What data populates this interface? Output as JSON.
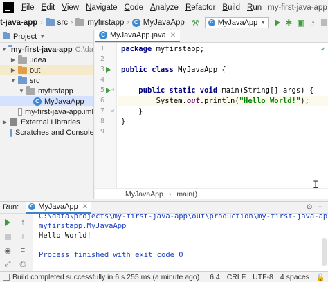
{
  "menubar": {
    "items": [
      "File",
      "Edit",
      "View",
      "Navigate",
      "Code",
      "Analyze",
      "Refactor",
      "Build",
      "Run"
    ],
    "window_title": "my-first-java-app"
  },
  "navbar": {
    "crumbs": [
      "t-java-app",
      "src",
      "myfirstapp",
      "MyJavaApp"
    ],
    "run_config": "MyJavaApp"
  },
  "project": {
    "header": "Project",
    "tree": [
      {
        "label": "my-first-java-app",
        "note": "C:\\data\\",
        "depth": 0,
        "expanded": true,
        "icon": "folder"
      },
      {
        "label": ".idea",
        "depth": 1,
        "expanded": false,
        "icon": "folder-grey"
      },
      {
        "label": "out",
        "depth": 1,
        "expanded": false,
        "icon": "folder-orange",
        "highlight": true
      },
      {
        "label": "src",
        "depth": 1,
        "expanded": true,
        "icon": "folder-blue"
      },
      {
        "label": "myfirstapp",
        "depth": 2,
        "expanded": true,
        "icon": "package"
      },
      {
        "label": "MyJavaApp",
        "depth": 3,
        "icon": "class",
        "selected": true
      },
      {
        "label": "my-first-java-app.iml",
        "depth": 1,
        "icon": "file"
      },
      {
        "label": "External Libraries",
        "depth": 0,
        "expanded": false,
        "icon": "library"
      },
      {
        "label": "Scratches and Consoles",
        "depth": 0,
        "expanded": false,
        "icon": "scratches"
      }
    ]
  },
  "editor": {
    "tab_label": "MyJavaApp.java",
    "line_numbers": [
      "1",
      "2",
      "3",
      "4",
      "5",
      "6",
      "7",
      "8",
      "9"
    ],
    "breadcrumb": [
      "MyJavaApp",
      "main()"
    ]
  },
  "run": {
    "tab_prefix": "Run:",
    "tab_label": "MyJavaApp",
    "output": [
      "C:\\data\\projects\\my-first-java-app\\out\\production\\my-first-java-app",
      "myfirstapp.MyJavaApp",
      "Hello World!",
      "",
      "Process finished with exit code 0"
    ]
  },
  "status": {
    "message": "Build completed successfully in 6 s 255 ms (a minute ago)",
    "position": "6:4",
    "line_sep": "CRLF",
    "encoding": "UTF-8",
    "indent": "4 spaces"
  },
  "colors": {
    "accent": "#4083c9",
    "run_green": "#3f9b3f",
    "selection": "#d4e2ff"
  }
}
